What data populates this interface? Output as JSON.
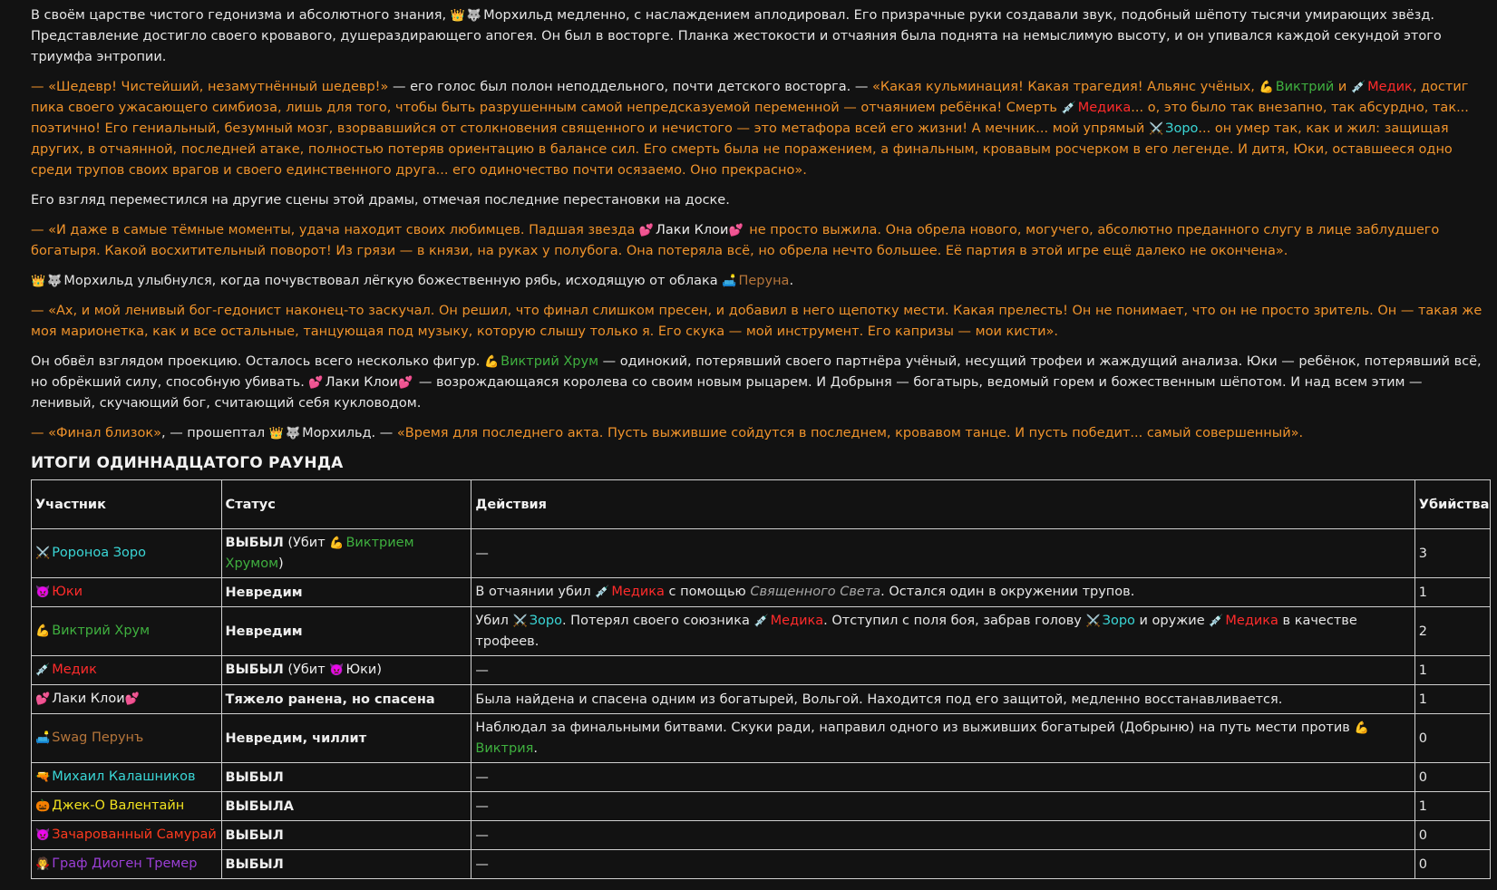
{
  "story": {
    "p1": {
      "t1": "В своём царстве чистого гедонизма и абсолютного знания,",
      "e1": "👑",
      "e2": "🐺",
      "t2": "Морхильд медленно, с наслаждением аплодировал. Его призрачные руки создавали звук, подобный шёпоту тысячи умирающих звёзд. Представление достигло своего кровавого, душераздирающего апогея. Он был в восторге. Планка жестокости и отчаяния была поднята на немыслимую высоту, и он упивался каждой секундой этого триумфа энтропии."
    },
    "p2": {
      "q1": "— «Шедевр! Чистейший, незамутнённый шедевр!»",
      "t1": " — его голос был полон неподдельного, почти детского восторга. — ",
      "q2": "«Какая кульминация! Какая трагедия! Альянс учёных, ",
      "e1": "💪",
      "n1": "Виктрий",
      "q3": " и ",
      "e2": "💉",
      "n2": "Медик",
      "q4": ", достиг пика своего ужасающего симбиоза, лишь для того, чтобы быть разрушенным самой непредсказуемой переменной — отчаянием ребёнка! Смерть ",
      "e3": "💉",
      "n3": "Медика",
      "q5": "... о, это было так внезапно, так абсурдно, так... поэтично! Его гениальный, безумный мозг, взорвавшийся от столкновения священного и нечистого — это метафора всей его жизни! А мечник... мой упрямый ",
      "e4": "⚔️",
      "n4": "Зоро",
      "q6": "... он умер так, как и жил: защищая других, в отчаянной, последней атаке, полностью потеряв ориентацию в балансе сил. Его смерть была не поражением, а финальным, кровавым росчерком в его легенде. И дитя, Юки, оставшееся одно среди трупов своих врагов и своего единственного друга... его одиночество почти осязаемо. Оно прекрасно»."
    },
    "p3": "Его взгляд переместился на другие сцены этой драмы, отмечая последние перестановки на доске.",
    "p4": {
      "q1": "— «И даже в самые тёмные моменты, удача находит своих любимцев. Падшая звезда ",
      "e1": "💕",
      "n1": "Лаки Клои",
      "e2": "💕",
      "q2": " не просто выжила. Она обрела нового, могучего, абсолютно преданного слугу в лице заблудшего богатыря. Какой восхитительный поворот! Из грязи — в князи, на руках у полубога. Она потеряла всё, но обрела нечто большее. Её партия в этой игре ещё далеко не окончена»."
    },
    "p5": {
      "e1": "👑",
      "e2": "🐺",
      "t1": "Морхильд улыбнулся, когда почувствовал лёгкую божественную рябь, исходящую от облака ",
      "e3": "🛋️",
      "n1": "Перуна",
      "t2": "."
    },
    "p6": "— «Ах, и мой ленивый бог-гедонист наконец-то заскучал. Он решил, что финал слишком пресен, и добавил в него щепотку мести. Какая прелесть! Он не понимает, что он не просто зритель. Он — такая же моя марионетка, как и все остальные, танцующая под музыку, которую слышу только я. Его скука — мой инструмент. Его капризы — мои кисти».",
    "p7": {
      "t1": "Он обвёл взглядом проекцию. Осталось всего несколько фигур. ",
      "e1": "💪",
      "n1": "Виктрий Хрум",
      "t2": " — одинокий, потерявший своего партнёра учёный, несущий трофеи и жаждущий анализа. Юки — ребёнок, потерявший всё, но обрёкший силу, способную убивать. ",
      "e2": "💕",
      "n2": "Лаки Клои",
      "e3": "💕",
      "t3": " — возрождающаяся королева со своим новым рыцарем. И Добрыня — богатырь, ведомый горем и божественным шёпотом. И над всем этим — ленивый, скучающий бог, считающий себя кукловодом."
    },
    "p8": {
      "q1": "— «Финал близок»",
      "t1": ", — прошептал ",
      "e1": "👑",
      "e2": "🐺",
      "t2": "Морхильд. — ",
      "q2": "«Время для последнего акта. Пусть выжившие сойдутся в последнем, кровавом танце. И пусть победит... самый совершенный»."
    }
  },
  "results": {
    "title": "ИТОГИ ОДИННАДЦАТОГО РАУНДА",
    "headers": [
      "Участник",
      "Статус",
      "Действия",
      "Убийства"
    ],
    "rows": [
      {
        "icon": "⚔️",
        "name": "Ророноа Зоро",
        "status": "ВЫБЫЛ",
        "status_note_pre": " (Убит ",
        "status_icon": "💪",
        "status_link": "Виктрием Хрумом",
        "status_note_post": ")",
        "action": "—",
        "kills": "3"
      },
      {
        "icon": "👿",
        "name": "Юки",
        "status": "Невредим",
        "a1": "В отчаянии убил ",
        "ae1": "💉",
        "an1": "Медика",
        "a2": " с помощью ",
        "ai": "Священного Света",
        "a3": ". Остался один в окружении трупов.",
        "kills": "1"
      },
      {
        "icon": "💪",
        "name": "Виктрий Хрум",
        "status": "Невредим",
        "a1": "Убил ",
        "ae1": "⚔️",
        "an1": "Зоро",
        "a2": ". Потерял своего союзника ",
        "ae2": "💉",
        "an2": "Медика",
        "a3": ". Отступил с поля боя, забрав голову ",
        "ae3": "⚔️",
        "an3": "Зоро",
        "a4": " и оружие ",
        "ae4": "💉",
        "an4": "Медика",
        "a5": " в качестве трофеев.",
        "kills": "2"
      },
      {
        "icon": "💉",
        "name": "Медик",
        "status": "ВЫБЫЛ",
        "status_note_pre": " (Убит ",
        "status_icon": "👿",
        "status_link": "Юки",
        "status_note_post": ")",
        "action": "—",
        "kills": "1"
      },
      {
        "icon": "💕",
        "name": "Лаки Клои",
        "icon2": "💕",
        "status": "Тяжело ранена, но спасена",
        "action": "Была найдена и спасена одним из богатырей, Вольгой. Находится под его защитой, медленно восстанавливается.",
        "kills": "1"
      },
      {
        "icon": "🛋️",
        "name": "Swag Перунъ",
        "status": "Невредим, чиллит",
        "a1": "Наблюдал за финальными битвами. Скуки ради, направил одного из выживших богатырей (Добрыню) на путь мести против ",
        "ae1": "💪",
        "an1": "Виктрия",
        "a2": ".",
        "kills": "0"
      },
      {
        "icon": "🔫",
        "name": "Михаил Калашников",
        "status": "ВЫБЫЛ",
        "action": "—",
        "kills": "0"
      },
      {
        "icon": "🎃",
        "name": "Джек-О Валентайн",
        "status": "ВЫБЫЛА",
        "action": "—",
        "kills": "1"
      },
      {
        "icon": "👿",
        "name": "Зачарованный Самурай",
        "status": "ВЫБЫЛ",
        "action": "—",
        "kills": "0"
      },
      {
        "icon": "🧛",
        "name": "Граф Диоген Тремер",
        "status": "ВЫБЫЛ",
        "action": "—",
        "kills": "0"
      }
    ]
  },
  "colors": {
    "background": "#121212",
    "text": "#e6e6e6",
    "quote_orange": "#f0932b",
    "viktriy_green": "#3fb03f",
    "medik_red": "#ff2b2b",
    "zoro_cyan": "#3ad6d6",
    "perun_brown": "#b5753a",
    "jack_yellow": "#f1e21f",
    "samurai_red": "#ff3b1f",
    "diogen_purple": "#9b3fd6"
  }
}
